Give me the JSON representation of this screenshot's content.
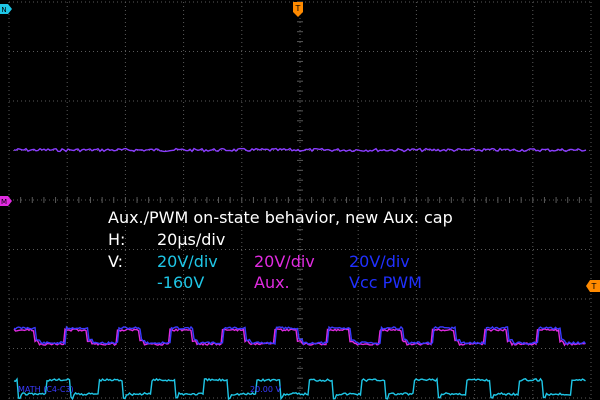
{
  "annotation": {
    "title": "Aux./PWM on-state behavior, new Aux. cap",
    "h_label": "H:",
    "h_value": "20µs/div",
    "v_label": "V:",
    "channels": [
      {
        "scale": "20V/div",
        "name": "-160V",
        "color": "#1fc6e6"
      },
      {
        "scale": "20V/div",
        "name": "Aux.",
        "color": "#e02be0"
      },
      {
        "scale": "20V/div",
        "name": "Vcc PWM",
        "color": "#2030ff"
      }
    ]
  },
  "markers": {
    "trigger_top": "T",
    "trigger_right": "T",
    "ch_cyan": "N",
    "ch_purple": "M"
  },
  "footer": {
    "math": "MATH (C4-C3)",
    "scale": "20.00 V"
  },
  "colors": {
    "grid": "#5a5a5a",
    "purple_trace": "#8a3cff",
    "blue_trace": "#3a3aff",
    "magenta_trace": "#e02be0",
    "cyan_trace": "#1fc6e6",
    "trigger": "#ff8a00"
  }
}
